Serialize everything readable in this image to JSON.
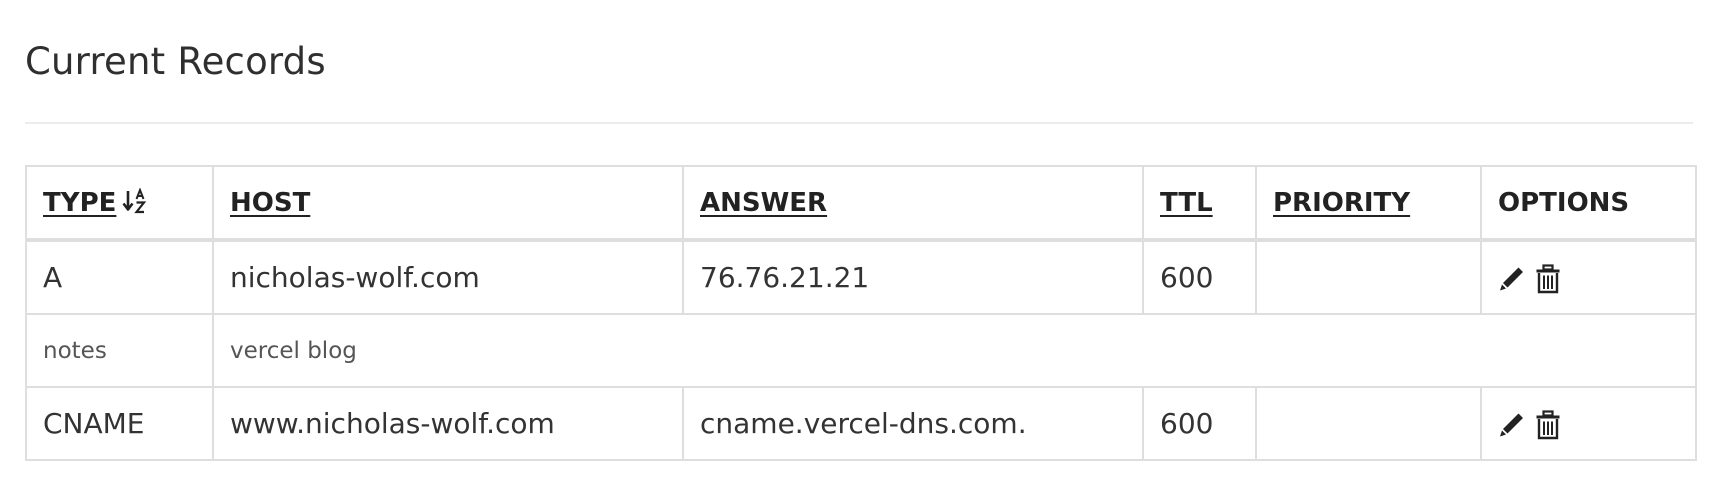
{
  "page": {
    "title": "Current Records"
  },
  "table": {
    "headers": {
      "type": "TYPE",
      "host": "HOST",
      "answer": "ANSWER",
      "ttl": "TTL",
      "priority": "PRIORITY",
      "options": "OPTIONS"
    },
    "sort_icon": "sort-ascending-az-icon",
    "records": [
      {
        "type": "A",
        "host": "nicholas-wolf.com",
        "answer": "76.76.21.21",
        "ttl": "600",
        "priority": "",
        "notes_label": "notes",
        "notes": "vercel blog"
      },
      {
        "type": "CNAME",
        "host": "www.nicholas-wolf.com",
        "answer": "cname.vercel-dns.com.",
        "ttl": "600",
        "priority": ""
      }
    ],
    "option_icons": [
      "edit-icon",
      "trash-icon"
    ]
  },
  "colors": {
    "text": "#333333",
    "header_text": "#222222",
    "border": "#dedede",
    "divider": "#ececec",
    "background": "#ffffff"
  }
}
